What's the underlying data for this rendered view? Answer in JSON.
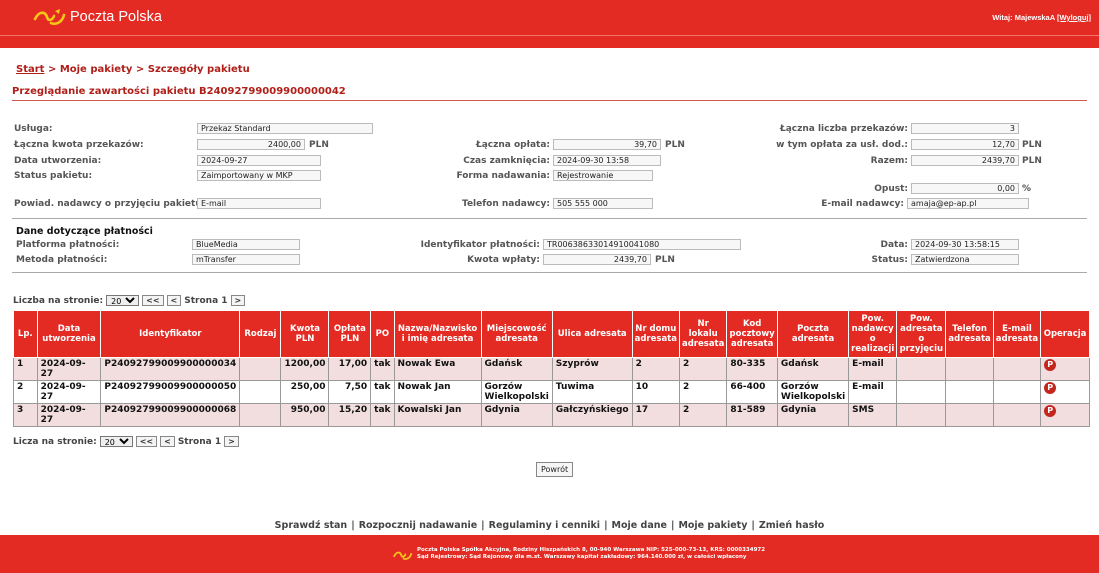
{
  "header": {
    "brand": "Poczta Polska",
    "welcome_prefix": "Witaj: MajewskaA",
    "logout_label": "[Wyloguj]"
  },
  "breadcrumb": {
    "start": "Start",
    "sep": ">",
    "packages": "Moje pakiety",
    "details": "Szczegóły pakietu"
  },
  "page_title": "Przeglądanie zawartości pakietu B24092799009900000042",
  "summary": {
    "usluga_label": "Usługa:",
    "usluga_value": "Przekaz Standard",
    "laczna_kwota_label": "Łączna kwota przekazów:",
    "laczna_kwota_value": "2400,00",
    "data_utw_label": "Data utworzenia:",
    "data_utw_value": "2024-09-27",
    "status_pak_label": "Status pakietu:",
    "status_pak_value": "Zaimportowany w MKP",
    "powiad_label": "Powiad. nadawcy o przyjęciu pakietu:",
    "powiad_value": "E-mail",
    "laczna_oplata_label": "Łączna opłata:",
    "laczna_oplata_value": "39,70",
    "czas_zamk_label": "Czas zamknięcia:",
    "czas_zamk_value": "2024-09-30 13:58",
    "forma_label": "Forma nadawania:",
    "forma_value": "Rejestrowanie",
    "telefon_label": "Telefon nadawcy:",
    "telefon_value": "505 555 000",
    "liczba_label": "Łączna liczba przekazów:",
    "liczba_value": "3",
    "oplata_dod_label": "w tym opłata za usł. dod.:",
    "oplata_dod_value": "12,70",
    "razem_label": "Razem:",
    "razem_value": "2439,70",
    "opust_label": "Opust:",
    "opust_value": "0,00",
    "opust_unit": "%",
    "email_label": "E-mail nadawcy:",
    "email_value": "amaja@ep-ap.pl",
    "currency": "PLN"
  },
  "payment": {
    "section_title": "Dane dotyczące płatności",
    "platforma_label": "Platforma płatności:",
    "platforma_value": "BlueMedia",
    "metoda_label": "Metoda płatności:",
    "metoda_value": "mTransfer",
    "ident_label": "Identyfikator płatności:",
    "ident_value": "TR00638633014910041080",
    "kwota_label": "Kwota wpłaty:",
    "kwota_value": "2439,70",
    "data_label": "Data:",
    "data_value": "2024-09-30 13:58:15",
    "status_label": "Status:",
    "status_value": "Zatwierdzona"
  },
  "pager_top": {
    "label": "Liczba na stronie:",
    "per_page": "20",
    "prev2": "<<",
    "prev": "<",
    "page": "Strona 1",
    "next": ">"
  },
  "pager_bottom": {
    "label": "Licza na stronie:",
    "per_page": "20",
    "prev2": "<<",
    "prev": "<",
    "page": "Strona 1",
    "next": ">"
  },
  "table": {
    "headers": [
      "Lp.",
      "Data utworzenia",
      "Identyfikator",
      "Rodzaj",
      "Kwota PLN",
      "Opłata PLN",
      "PO",
      "Nazwa/Nazwisko i imię adresata",
      "Miejscowość adresata",
      "Ulica adresata",
      "Nr domu adresata",
      "Nr lokalu adresata",
      "Kod pocztowy adresata",
      "Poczta adresata",
      "Pow. nadawcy o realizacji",
      "Pow. adresata o przyjęciu",
      "Telefon adresata",
      "E-mail adresata",
      "Operacja"
    ],
    "rows": [
      {
        "lp": "1",
        "data": "2024-09-27",
        "id": "P24092799009900000034",
        "rodzaj": "",
        "kwota": "1200,00",
        "oplata": "17,00",
        "po": "tak",
        "nazwa": "Nowak Ewa",
        "miejsc": "Gdańsk",
        "ulica": "Szyprów",
        "nr_domu": "2",
        "nr_lok": "2",
        "kod": "80-335",
        "poczta": "Gdańsk",
        "pow_nad": "E-mail",
        "pow_adr": "",
        "tel": "",
        "email": "",
        "op": "P"
      },
      {
        "lp": "2",
        "data": "2024-09-27",
        "id": "P24092799009900000050",
        "rodzaj": "",
        "kwota": "250,00",
        "oplata": "7,50",
        "po": "tak",
        "nazwa": "Nowak Jan",
        "miejsc": "Gorzów Wielkopolski",
        "ulica": "Tuwima",
        "nr_domu": "10",
        "nr_lok": "2",
        "kod": "66-400",
        "poczta": "Gorzów Wielkopolski",
        "pow_nad": "E-mail",
        "pow_adr": "",
        "tel": "",
        "email": "",
        "op": "P"
      },
      {
        "lp": "3",
        "data": "2024-09-27",
        "id": "P24092799009900000068",
        "rodzaj": "",
        "kwota": "950,00",
        "oplata": "15,20",
        "po": "tak",
        "nazwa": "Kowalski Jan",
        "miejsc": "Gdynia",
        "ulica": "Gałczyńskiego",
        "nr_domu": "17",
        "nr_lok": "2",
        "kod": "81-589",
        "poczta": "Gdynia",
        "pow_nad": "SMS",
        "pow_adr": "",
        "tel": "",
        "email": "",
        "op": "P"
      }
    ]
  },
  "back_label": "Powrót",
  "footer_links": [
    "Sprawdź stan",
    "Rozpocznij nadawanie",
    "Regulaminy i cenniki",
    "Moje dane",
    "Moje pakiety",
    "Zmień hasło"
  ],
  "footer_sep": "|",
  "footer_text_1": "Poczta Polska Spółka Akcyjna, Rodziny Hiszpańskich 8, 00-940 Warszawa NIP: 525-000-73-13, KRS: 0000334972",
  "footer_text_2": "Sąd Rejestrowy: Sąd Rejonowy dla m.st. Warszawy kapitał zakładowy: 964.140.000 zł, w całości wpłacony",
  "colors": {
    "brand_red": "#e32b24",
    "dark_red": "#b01e18",
    "row_pink": "#f2dedf"
  }
}
